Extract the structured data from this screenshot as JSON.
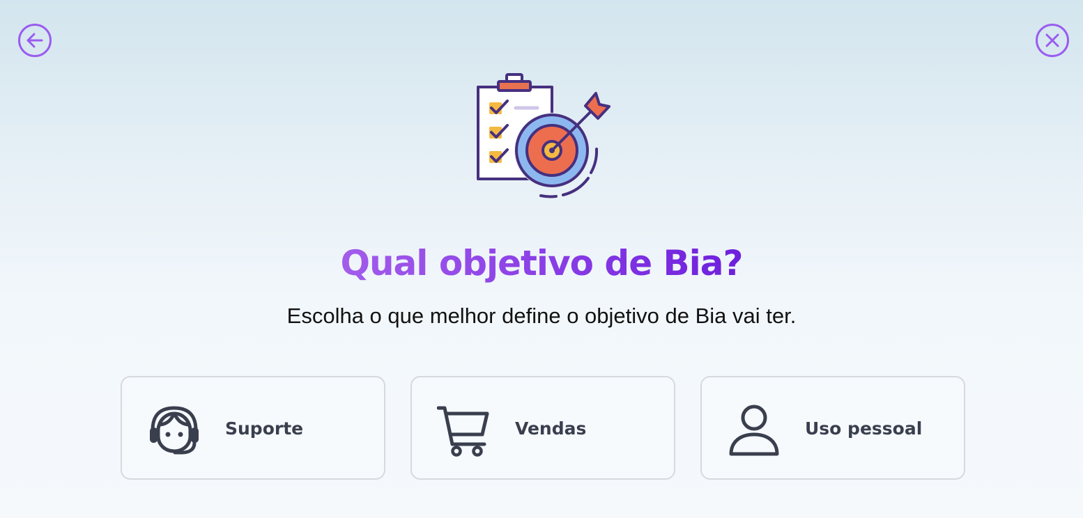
{
  "nav": {
    "back_icon": "arrow-left-circle-icon",
    "close_icon": "x-circle-icon",
    "icon_color": "#9a5cf0"
  },
  "hero": {
    "illustration": "checklist-target-illustration",
    "title": "Qual objetivo de Bia?",
    "subtitle": "Escolha o que melhor define o objetivo de Bia vai ter.",
    "title_gradient": [
      "#a35ceb",
      "#6d1fdc"
    ]
  },
  "options": [
    {
      "label": "Suporte",
      "icon": "support-agent-icon"
    },
    {
      "label": "Vendas",
      "icon": "shopping-cart-icon"
    },
    {
      "label": "Uso pessoal",
      "icon": "user-icon"
    }
  ],
  "colors": {
    "accent": "#9a5cf0",
    "text_dark": "#121212",
    "card_label": "#3a3f4e",
    "card_border": "#d6d9de"
  }
}
